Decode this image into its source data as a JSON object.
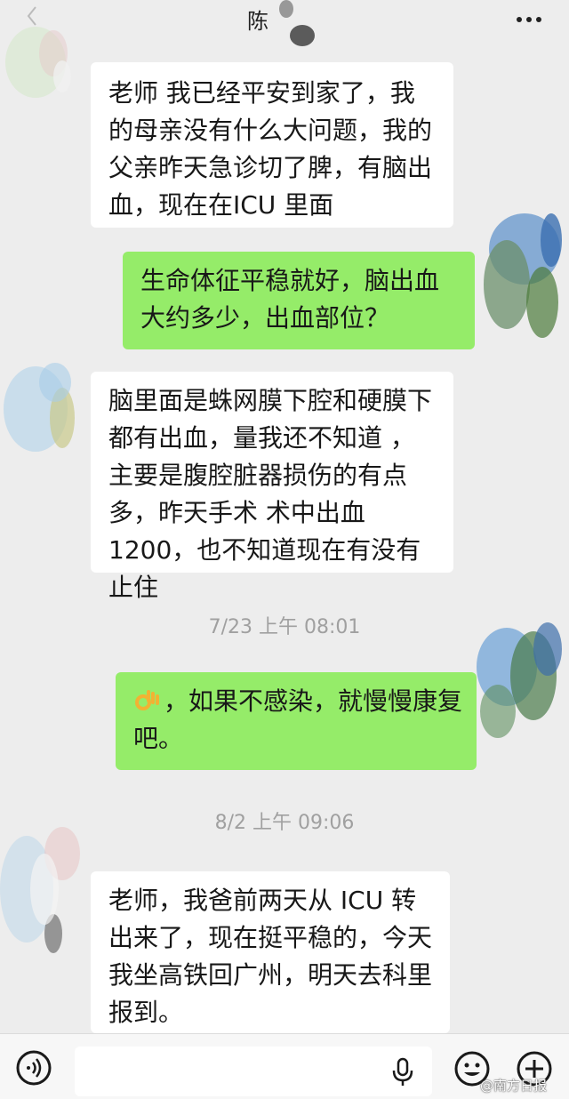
{
  "header": {
    "title": "陈",
    "back_icon": "chevron-left-icon",
    "more_icon": "more-dots-icon"
  },
  "messages": [
    {
      "side": "in",
      "text": "老师 我已经平安到家了，我的母亲没有什么大问题，我的父亲昨天急诊切了脾，有脑出血，现在在ICU 里面"
    },
    {
      "side": "out",
      "text": "生命体征平稳就好，脑出血大约多少，出血部位？"
    },
    {
      "side": "in",
      "text": "脑里面是蛛网膜下腔和硬膜下都有出血，量我还不知道 ，主要是腹腔脏器损伤的有点多，昨天手术 术中出血1200，也不知道现在有没有止住"
    },
    {
      "side": "out",
      "emoji": "ok-hand-emoji",
      "text": "，如果不感染，就慢慢康复吧。"
    },
    {
      "side": "in",
      "text": "老师，我爸前两天从 ICU 转出来了，现在挺平稳的，今天我坐高铁回广州，明天去科里报到。"
    }
  ],
  "timestamps": [
    "7/23 上午 08:01",
    "8/2 上午 09:06"
  ],
  "input_bar": {
    "voice_icon": "voice-icon",
    "mic_icon": "mic-icon",
    "emoji_icon": "emoji-icon",
    "plus_icon": "plus-icon"
  },
  "watermark": "@南方日报",
  "colors": {
    "background": "#ededed",
    "incoming_bubble": "#ffffff",
    "outgoing_bubble": "#95ec69",
    "timestamp_text": "#a0a0a0"
  }
}
